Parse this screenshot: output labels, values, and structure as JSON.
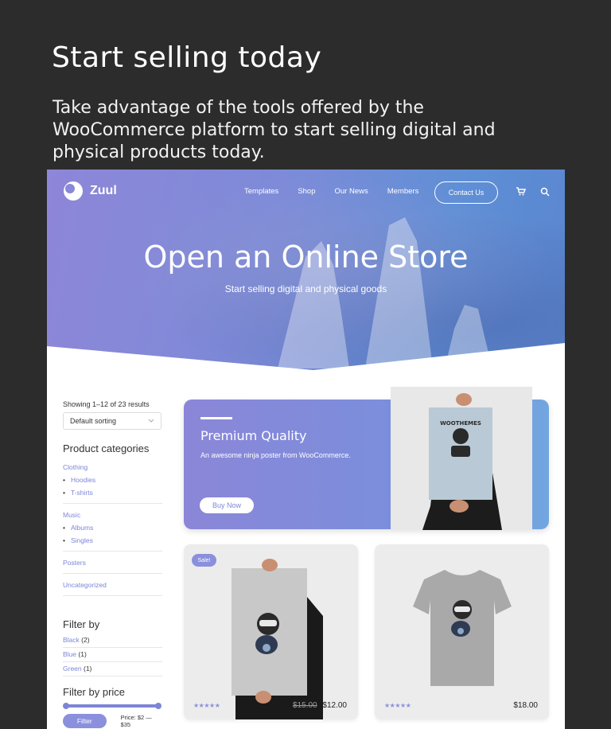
{
  "promo_header": {
    "title": "Start selling today",
    "description": "Take advantage of the tools offered by the WooCommerce platform to start selling digital and physical products today."
  },
  "site": {
    "logo": "Zuul",
    "nav": [
      "Templates",
      "Shop",
      "Our News",
      "Members"
    ],
    "contact_label": "Contact Us",
    "hero_title": "Open an Online Store",
    "hero_subtitle": "Start selling digital and physical goods"
  },
  "sidebar": {
    "results": "Showing 1–12 of 23 results",
    "sort_value": "Default sorting",
    "categories_heading": "Product categories",
    "categories": {
      "clothing": "Clothing",
      "hoodies": "Hoodies",
      "tshirts": "T-shirts",
      "music": "Music",
      "albums": "Albums",
      "singles": "Singles",
      "posters": "Posters",
      "uncategorized": "Uncategorized"
    },
    "filter_heading": "Filter by",
    "filters": [
      {
        "name": "Black",
        "count": "(2)"
      },
      {
        "name": "Blue",
        "count": "(1)"
      },
      {
        "name": "Green",
        "count": "(1)"
      }
    ],
    "price_heading": "Filter by price",
    "filter_button": "Filter",
    "price_range": "Price: $2 — $35"
  },
  "promo": {
    "title": "Premium Quality",
    "description": "An awesome ninja poster from WooCommerce.",
    "button": "Buy Now",
    "poster_text": "WOOTHEMES"
  },
  "products": [
    {
      "badge": "Sale!",
      "stars": "★★★★★",
      "old_price": "$15.00",
      "price": "$12.00"
    },
    {
      "stars": "★★★★★",
      "price": "$18.00"
    }
  ],
  "colors": {
    "accent": "#7d86d6",
    "page_bg": "#2c2c2c",
    "hero_start": "#8e86d8",
    "hero_end": "#5a86cf"
  }
}
